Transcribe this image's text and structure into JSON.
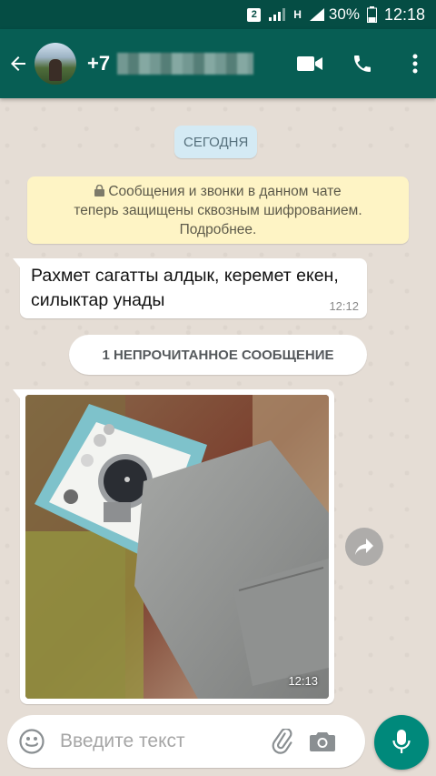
{
  "status_bar": {
    "sim": "2",
    "network": "H",
    "battery": "30%",
    "time": "12:18"
  },
  "header": {
    "contact_prefix": "+7"
  },
  "chat": {
    "date_chip": "СЕГОДНЯ",
    "encryption_notice": {
      "line1": "Сообщения и звонки в данном чате",
      "line2": "теперь защищены сквозным шифрованием.",
      "line3": "Подробнее."
    },
    "messages": [
      {
        "text": "Рахмет сагатты алдык, керемет екен, силыктар унады",
        "time": "12:12"
      }
    ],
    "unread_label": "1 НЕПРОЧИТАННОЕ СООБЩЕНИЕ",
    "image_message": {
      "time": "12:13"
    }
  },
  "composer": {
    "placeholder": "Введите текст"
  },
  "icons": {
    "back": "arrow-left-icon",
    "video": "video-camera-icon",
    "call": "phone-icon",
    "menu": "more-vertical-icon",
    "lock": "lock-icon",
    "forward": "share-forward-icon",
    "emoji": "smiley-icon",
    "attach": "paperclip-icon",
    "camera": "camera-icon",
    "mic": "microphone-icon"
  },
  "colors": {
    "header": "#075e54",
    "status_bar": "#054d44",
    "chat_bg": "#e5ddd5",
    "date_chip": "#d4eaf4",
    "notice": "#fef4c5",
    "mic_button": "#00897b"
  }
}
